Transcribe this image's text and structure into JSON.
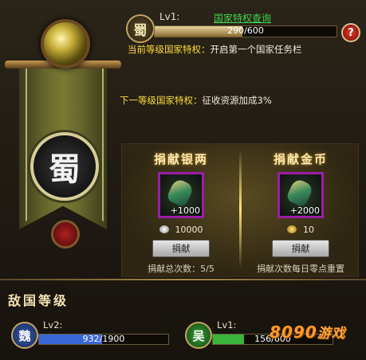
{
  "nation": {
    "badge": "蜀",
    "emblem": "蜀",
    "level_label": "Lv1:",
    "query_link": "国家特权查询",
    "exp_text": "290/600",
    "exp_fraction": 0.483
  },
  "privileges": {
    "current_label": "当前等级国家特权：",
    "current_text": "开启第一个国家任务栏",
    "next_label": "下一等级国家特权：",
    "next_text": "征收资源加成3%"
  },
  "donate": {
    "silver": {
      "title": "捐献银两",
      "qty": "+1000",
      "cost": "10000",
      "button": "捐献",
      "count": "捐献总次数：5/5"
    },
    "gold": {
      "title": "捐献金币",
      "qty": "+2000",
      "cost": "10",
      "button": "捐献",
      "count": "捐献次数每日零点重置"
    }
  },
  "enemy": {
    "title": "敌国等级",
    "nations": [
      {
        "badge": "魏",
        "level": "Lv2:",
        "exp_text": "932/1900",
        "fraction": 0.49,
        "color": "#3a66d8"
      },
      {
        "badge": "吴",
        "level": "Lv1:",
        "exp_text": "156/600",
        "fraction": 0.26,
        "color": "#3ab43a"
      }
    ]
  },
  "watermark": {
    "text": "8090",
    "cn": "游戏"
  },
  "colors": {
    "privilege_label": "#ffdc3a",
    "query_link": "#3fd34a",
    "accent_purple": "#9a1ea8"
  }
}
